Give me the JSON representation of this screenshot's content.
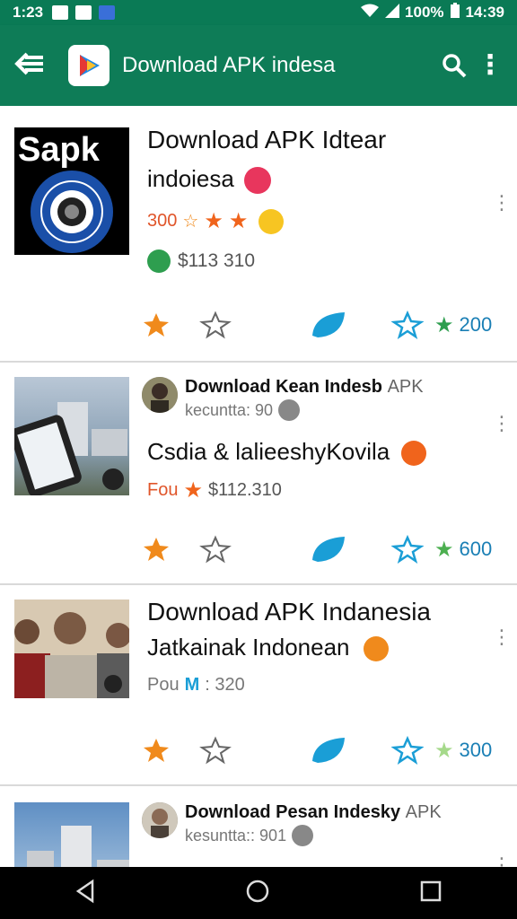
{
  "status_bar": {
    "time": "1:23",
    "battery": "100%",
    "clock": "14:39"
  },
  "app_bar": {
    "title": "Download APK indesa"
  },
  "cards": [
    {
      "title": "Download APK Idtear",
      "subtitle": "indoiesa",
      "rating": "300",
      "price": "$113 310",
      "thumb_text": "Sapk",
      "action_count": "200"
    },
    {
      "author_name": "Download Kean Indesb",
      "author_suffix": "APK",
      "author_meta": "kecuntta: 90",
      "subtitle": "Csdia & lalieeshyKovila",
      "rating_label": "Fou",
      "price": "$112.310",
      "action_count": "600"
    },
    {
      "title": "Download APK Indanesia",
      "subtitle": "Jatkainak Indonean",
      "rating_label": "Pou",
      "rating": ": 320",
      "action_count": "300"
    },
    {
      "author_name": "Download Pesan Indesky",
      "author_suffix": "APK",
      "author_meta": "kesuntta:: 901"
    }
  ],
  "icons": {
    "back": "back-arrow-icon",
    "search": "search-icon",
    "more": "more-vert-icon"
  },
  "colors": {
    "app_bar": "#0e7c57",
    "status_bar": "#0a7a55",
    "accent_orange": "#f08a1c",
    "accent_blue": "#1a9ed6",
    "count_blue": "#1a7fb5"
  }
}
